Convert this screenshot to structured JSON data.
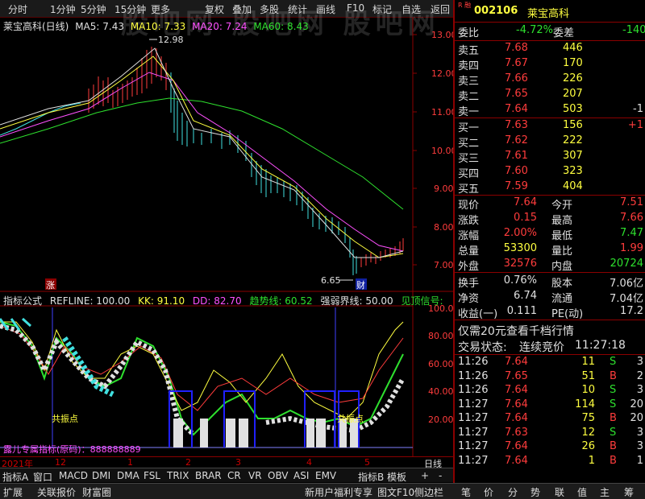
{
  "toolbar": {
    "items": [
      "分时",
      "1分钟",
      "5分钟",
      "15分钟",
      "更多",
      "复权",
      "叠加",
      "多股",
      "统计",
      "画线",
      "F10",
      "标记",
      "自选",
      "返回"
    ]
  },
  "watermark": "股吧网 股吧网 股吧网",
  "chart_title": {
    "name": "莱宝高科(日线)",
    "ma5": "MA5: 7.43",
    "ma10": "MA10: 7.33",
    "ma20": "MA20: 7.24",
    "ma60": "MA60: 8.43"
  },
  "price_axis": [
    "13.00",
    "12.00",
    "11.00",
    "10.00",
    "9.00",
    "8.00",
    "7.00"
  ],
  "indicator_axis": [
    "100.0",
    "80.00",
    "60.00",
    "40.00",
    "20.00"
  ],
  "annotations": {
    "high": "12.98",
    "low": "6.65",
    "badge_zhang": "涨",
    "badge_cai": "财",
    "gongzhen1": "共振点",
    "gongzhen2": "共振点",
    "promo": "露儿专属指标(原码)：888888889"
  },
  "indicator_title": {
    "name": "指标公式",
    "refline": "REFLINE: 100.00",
    "kk": "KK: 91.10",
    "dd": "DD: 82.70",
    "trend": "趋势线: 60.52",
    "strong": "强弱界线: 50.00",
    "signal": "见顶信号:"
  },
  "x_axis": [
    "2021年",
    "12",
    "1",
    "2",
    "3",
    "4",
    "5"
  ],
  "period_label": "日线",
  "tabs": [
    "指标A",
    "窗口",
    "MACD",
    "DMI",
    "DMA",
    "FSL",
    "TRIX",
    "BRAR",
    "CR",
    "VR",
    "OBV",
    "ASI",
    "EMV",
    "指标B",
    "模板",
    "+",
    "-"
  ],
  "bottom": [
    "扩展",
    "关联报价",
    "财富圈",
    "新用户福利专享",
    "图文F10",
    "侧边栏",
    "笔",
    "价",
    "分",
    "势",
    "联",
    "值",
    "主",
    "筹"
  ],
  "stock": {
    "code": "002106",
    "name": "莱宝高科",
    "tag": "R 融"
  },
  "weibi": {
    "label": "委比",
    "value": "-4.72%",
    "label2": "委差",
    "value2": "-140"
  },
  "sells": [
    {
      "label": "卖五",
      "price": "7.68",
      "vol": "446",
      "chg": ""
    },
    {
      "label": "卖四",
      "price": "7.67",
      "vol": "170",
      "chg": ""
    },
    {
      "label": "卖三",
      "price": "7.66",
      "vol": "226",
      "chg": ""
    },
    {
      "label": "卖二",
      "price": "7.65",
      "vol": "207",
      "chg": ""
    },
    {
      "label": "卖一",
      "price": "7.64",
      "vol": "503",
      "chg": "-1"
    }
  ],
  "buys": [
    {
      "label": "买一",
      "price": "7.63",
      "vol": "156",
      "chg": "+1"
    },
    {
      "label": "买二",
      "price": "7.62",
      "vol": "222",
      "chg": ""
    },
    {
      "label": "买三",
      "price": "7.61",
      "vol": "307",
      "chg": ""
    },
    {
      "label": "买四",
      "price": "7.60",
      "vol": "323",
      "chg": ""
    },
    {
      "label": "买五",
      "price": "7.59",
      "vol": "404",
      "chg": ""
    }
  ],
  "quotes": [
    {
      "l1": "现价",
      "v1": "7.64",
      "l2": "今开",
      "v2": "7.51"
    },
    {
      "l1": "涨跌",
      "v1": "0.15",
      "l2": "最高",
      "v2": "7.66"
    },
    {
      "l1": "涨幅",
      "v1": "2.00%",
      "l2": "最低",
      "v2": "7.47"
    },
    {
      "l1": "总量",
      "v1": "53300",
      "l2": "量比",
      "v2": "1.99"
    },
    {
      "l1": "外盘",
      "v1": "32576",
      "l2": "内盘",
      "v2": "20724"
    }
  ],
  "fundamentals": [
    {
      "l1": "换手",
      "v1": "0.76%",
      "l2": "股本",
      "v2": "7.06亿"
    },
    {
      "l1": "净资",
      "v1": "6.74",
      "l2": "流通",
      "v2": "7.04亿"
    },
    {
      "l1": "收益(一)",
      "v1": "0.111",
      "l2": "PE(动)",
      "v2": "17.2"
    }
  ],
  "promo_line": "仅需20元查看千档行情",
  "trade_status": {
    "label": "交易状态:",
    "value": "连续竞价",
    "time": "11:27:18"
  },
  "ticks": [
    {
      "t": "11:26",
      "p": "7.64",
      "v": "11",
      "s": "S",
      "n": "3"
    },
    {
      "t": "11:26",
      "p": "7.65",
      "v": "51",
      "s": "B",
      "n": "2"
    },
    {
      "t": "11:26",
      "p": "7.64",
      "v": "10",
      "s": "S",
      "n": "3"
    },
    {
      "t": "11:27",
      "p": "7.64",
      "v": "114",
      "s": "S",
      "n": "20"
    },
    {
      "t": "11:27",
      "p": "7.64",
      "v": "75",
      "s": "B",
      "n": "20"
    },
    {
      "t": "11:27",
      "p": "7.63",
      "v": "12",
      "s": "S",
      "n": "3"
    },
    {
      "t": "11:27",
      "p": "7.64",
      "v": "26",
      "s": "B",
      "n": "3"
    },
    {
      "t": "11:27",
      "p": "7.64",
      "v": "1",
      "s": "B",
      "n": "1"
    }
  ]
}
